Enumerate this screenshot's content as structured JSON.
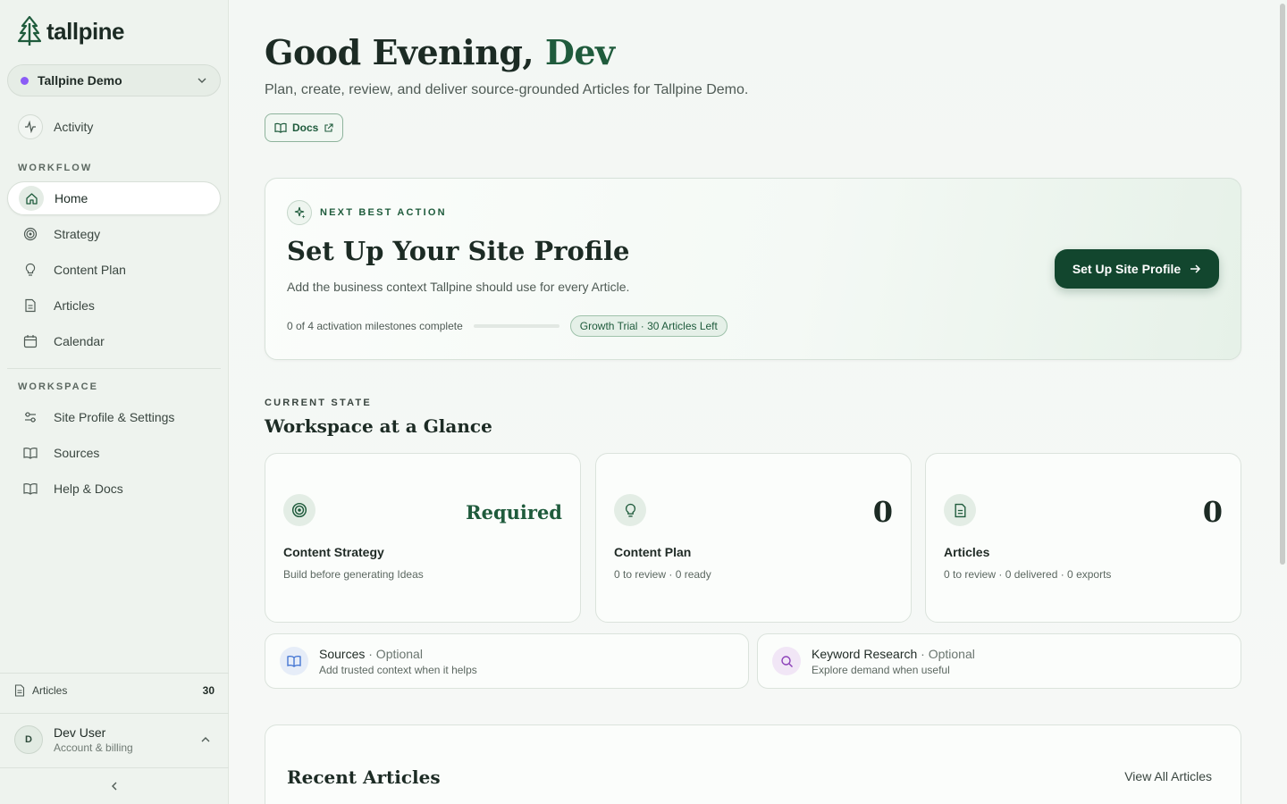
{
  "brand": {
    "name": "tallpine",
    "color": "#1f5b3c"
  },
  "workspace": {
    "name": "Tallpine Demo",
    "dot_color": "#8b5cf6"
  },
  "sidebar": {
    "activity": "Activity",
    "workflow_label": "WORKFLOW",
    "workflow_items": [
      {
        "label": "Home",
        "icon": "home-icon",
        "active": true
      },
      {
        "label": "Strategy",
        "icon": "target-icon"
      },
      {
        "label": "Content Plan",
        "icon": "lightbulb-icon"
      },
      {
        "label": "Articles",
        "icon": "document-icon"
      },
      {
        "label": "Calendar",
        "icon": "calendar-icon"
      }
    ],
    "workspace_label": "WORKSPACE",
    "workspace_items": [
      {
        "label": "Site Profile & Settings",
        "icon": "sliders-icon"
      },
      {
        "label": "Sources",
        "icon": "book-icon"
      },
      {
        "label": "Help & Docs",
        "icon": "book-icon"
      }
    ],
    "articles_label": "Articles",
    "articles_count": "30",
    "user": {
      "initial": "D",
      "name": "Dev User",
      "subtitle": "Account & billing"
    }
  },
  "header": {
    "greeting": "Good Evening,",
    "name": "Dev",
    "subtitle": "Plan, create, review, and deliver source-grounded Articles for Tallpine Demo.",
    "docs_label": "Docs"
  },
  "next_action": {
    "label": "NEXT BEST ACTION",
    "title": "Set Up Your Site Profile",
    "description": "Add the business context Tallpine should use for every Article.",
    "progress_text": "0 of 4 activation milestones complete",
    "progress_fraction": 0,
    "trial_pill": "Growth Trial · 30 Articles Left",
    "cta_label": "Set Up Site Profile"
  },
  "glance": {
    "label": "CURRENT STATE",
    "title": "Workspace at a Glance",
    "cards": [
      {
        "title": "Content Strategy",
        "value": "Required",
        "subtitle": "Build before generating Ideas",
        "icon": "target-icon"
      },
      {
        "title": "Content Plan",
        "value": "0",
        "subtitle": "0 to review · 0 ready",
        "icon": "lightbulb-icon"
      },
      {
        "title": "Articles",
        "value": "0",
        "subtitle": "0 to review · 0 delivered · 0 exports",
        "icon": "document-icon"
      }
    ],
    "optional": [
      {
        "title": "Sources",
        "tag": " · Optional",
        "subtitle": "Add trusted context when it helps",
        "icon": "book-icon",
        "color": "#3b6fd1"
      },
      {
        "title": "Keyword Research",
        "tag": " · Optional",
        "subtitle": "Explore demand when useful",
        "icon": "search-icon",
        "color": "#8b3fb8"
      }
    ]
  },
  "recent": {
    "title": "Recent Articles",
    "link": "View All Articles"
  }
}
